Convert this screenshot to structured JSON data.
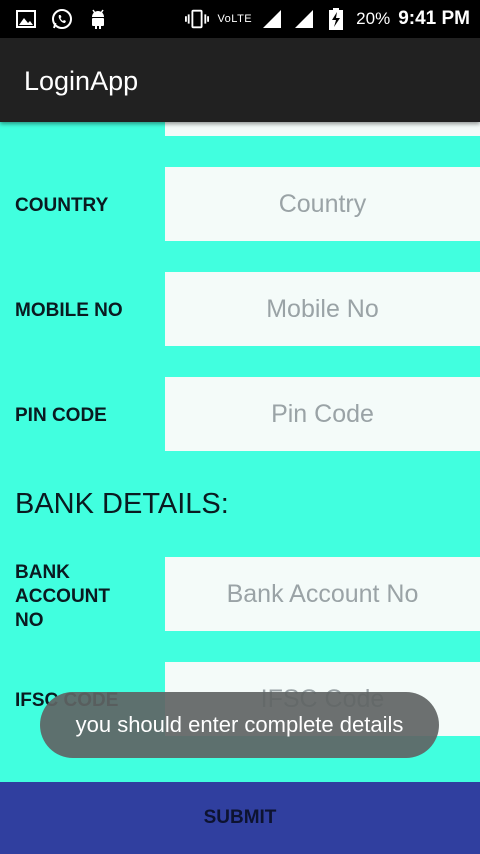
{
  "status_bar": {
    "network_label": "VoLTE",
    "battery_percent": "20%",
    "time": "9:41 PM",
    "left_icons": [
      "gallery-icon",
      "whatsapp-icon",
      "android-icon"
    ],
    "right_icons": [
      "vibrate-icon",
      "signal-icon",
      "signal-icon",
      "battery-charging-icon"
    ]
  },
  "app_bar": {
    "title": "LoginApp"
  },
  "form": {
    "country": {
      "label": "COUNTRY",
      "placeholder": "Country"
    },
    "mobile": {
      "label": "MOBILE NO",
      "placeholder": "Mobile No"
    },
    "pin": {
      "label": "PIN CODE",
      "placeholder": "Pin Code"
    },
    "bank_heading": "BANK DETAILS:",
    "bank_account": {
      "label_lines": [
        "BANK",
        "ACCOUNT",
        "NO"
      ],
      "placeholder": "Bank Account No"
    },
    "ifsc": {
      "label": "IFSC CODE",
      "placeholder": "IFSC Code"
    }
  },
  "toast": {
    "message": "you should enter complete details"
  },
  "submit": {
    "label": "SUBMIT"
  },
  "colors": {
    "background": "#41ffdf",
    "app_bar": "#212121",
    "submit": "#303f9f",
    "toast": "#606464"
  }
}
